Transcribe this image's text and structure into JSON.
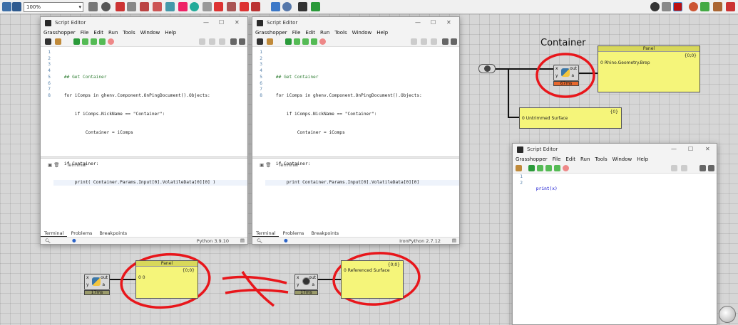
{
  "toolbar": {
    "zoom": "100%",
    "dropdown": "▾"
  },
  "editor1": {
    "title": "Script Editor",
    "menu": [
      "Grasshopper",
      "File",
      "Edit",
      "Run",
      "Tools",
      "Window",
      "Help"
    ],
    "line_numbers": [
      "1",
      "2",
      "3",
      "4",
      "5",
      "6",
      "7",
      "8"
    ],
    "lines": [
      "",
      "    ## Get Container",
      "    for iComps in ghenv.Component.OnPingDocument().Objects:",
      "        if iComps.NickName == \"Container\":",
      "            Container = iComps",
      "",
      "    if Container:",
      "        print( Container.Params.Input[0].VolatileData[0][0] )"
    ],
    "terminal": "Terminal",
    "tabs": [
      "Terminal",
      "Problems",
      "Breakpoints"
    ],
    "version": "Python 3.9.10"
  },
  "editor2": {
    "title": "Script Editor",
    "menu": [
      "Grasshopper",
      "File",
      "Edit",
      "Run",
      "Tools",
      "Window",
      "Help"
    ],
    "line_numbers": [
      "1",
      "2",
      "3",
      "4",
      "5",
      "6",
      "7",
      "8"
    ],
    "lines": [
      "",
      "    ## Get Container",
      "    for iComps in ghenv.Component.OnPingDocument().Objects:",
      "        if iComps.NickName == \"Container\":",
      "            Container = iComps",
      "",
      "    if Container:",
      "        print Container.Params.Input[0].VolatileData[0][0]"
    ],
    "terminal": "Terminal",
    "tabs": [
      "Terminal",
      "Problems",
      "Breakpoints"
    ],
    "version": "IronPython 2.7.12"
  },
  "editor3": {
    "title": "Script Editor",
    "menu": [
      "Grasshopper",
      "File",
      "Edit",
      "Run",
      "Tools",
      "Window",
      "Help"
    ],
    "line_numbers": [
      "1",
      "2"
    ],
    "lines": [
      "    print(x)",
      ""
    ]
  },
  "canvas": {
    "container_label": "Container",
    "container_comp": {
      "in": [
        "x",
        "y"
      ],
      "out": [
        "out",
        "a"
      ],
      "timer": "67ms"
    },
    "panel_top": {
      "title": "Panel",
      "count": "{0;0}",
      "value": "0 Rhino.Geometry.Brep"
    },
    "surface_panel": {
      "count": "{0}",
      "value": "0 Untrimmed Surface"
    },
    "bottom_comp1": {
      "in": [
        "x",
        "y"
      ],
      "out": [
        "out",
        "a"
      ],
      "timer": "17ms"
    },
    "bottom_panel1": {
      "title": "Panel",
      "count": "{0;0}",
      "value": "0 0"
    },
    "bottom_comp2": {
      "in": [
        "x",
        "y"
      ],
      "out": [
        "out",
        "a"
      ],
      "timer": "17ms"
    },
    "bottom_panel2": {
      "count": "{0;0}",
      "value": "0 Referenced Surface"
    }
  },
  "colors": {
    "annotation": "#e8161b",
    "panel": "#f5f57a",
    "timer_hot": "#e8672c",
    "timer": "#9a9a6a"
  }
}
